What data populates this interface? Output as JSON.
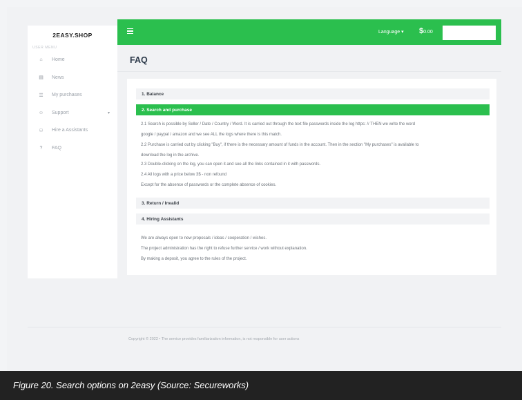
{
  "brand": "2EASY.SHOP",
  "sidebar": {
    "caption": "USER MENU",
    "items": [
      {
        "label": "Home",
        "icon": "home-icon",
        "glyph": "⌂"
      },
      {
        "label": "News",
        "icon": "news-icon",
        "glyph": "▤"
      },
      {
        "label": "My purchases",
        "icon": "cart-icon",
        "glyph": "☰"
      },
      {
        "label": "Support",
        "icon": "support-icon",
        "glyph": "☺"
      },
      {
        "label": "Hire a Assistants",
        "icon": "users-icon",
        "glyph": "⚇"
      },
      {
        "label": "FAQ",
        "icon": "question-icon",
        "glyph": "?"
      }
    ]
  },
  "topbar": {
    "language_label": "Language",
    "language_caret": "▾",
    "currency_symbol": "$",
    "balance": "0.00",
    "search_value": "",
    "accent_color": "#2bbf4e"
  },
  "page": {
    "title": "FAQ"
  },
  "faq": {
    "sections": [
      {
        "title": "1. Balance",
        "open": false
      },
      {
        "title": "2. Search and purchase",
        "open": true
      },
      {
        "title": "3. Return / Invalid",
        "open": false
      },
      {
        "title": "4. Hiring Assistants",
        "open": false
      }
    ],
    "search_purchase_lines": [
      "2.1 Search is possible by Seller / Date / Country / Word. It is carried out through the text file passwords inside the log https: // THEN we write the word",
      "google / paypal / amazon and we see ALL the logs where there is this match.",
      "2.2 Purchase is carried out by clicking \"Buy\", if there is the necessary amount of funds in the account. Then in the section \"My purchases\" is available to",
      "download the log in the archive.",
      "2.3 Double-clicking on the log, you can open it and see all the links contained in it with passwords.",
      "2.4 All logs with a price below 3$ - non refound",
      "Except for the absence of passwords or the complete absence of cookies."
    ],
    "footer_lines": [
      "We are always open to new proposals / ideas / cooperation / wishes.",
      "The project administration has the right to refuse further service / work without explanation.",
      "By making a deposit, you agree to the rules of the project."
    ]
  },
  "footer": {
    "text": "Copyright © 2022  •  The service provides familiarization information, is not responsible for user actions"
  },
  "caption": "Figure 20. Search options on 2easy (Source: Secureworks)"
}
